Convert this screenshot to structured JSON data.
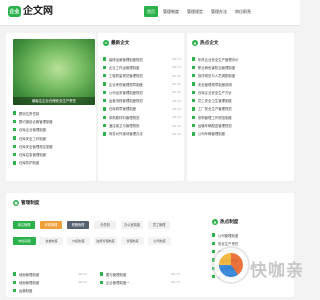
{
  "header": {
    "logo_badge": "企业",
    "logo_text": "企文网",
    "nav": [
      "首页",
      "管理制度",
      "管理规定",
      "管理办法",
      "岗位职责"
    ]
  },
  "featured": {
    "caption": "编者注企业仓储安全生产责任"
  },
  "left_list": [
    "履岗位责任制",
    "履约钢品合格管理制度",
    "仓库企业管理制度",
    "仓库安全工作制度",
    "仓库安全管理规定制度",
    "仓库应急管理制度",
    "仓库防护制度"
  ],
  "latest": {
    "title": "最新企文",
    "items": [
      {
        "text": "装修运营管理制度规范",
        "date": "08-13"
      },
      {
        "text": "企业工作运管理制度",
        "date": "08-13"
      },
      {
        "text": "工程质量规范管理规范",
        "date": "08-13"
      },
      {
        "text": "企业考勤管理规章制度",
        "date": "08-13"
      },
      {
        "text": "公司治安管理制度规范",
        "date": "08-13"
      },
      {
        "text": "运营流程管理制度规范",
        "date": "08-13"
      },
      {
        "text": "仓库规章管理制度",
        "date": "08-13"
      },
      {
        "text": "采购原材料管理规范",
        "date": "08-13"
      },
      {
        "text": "酒店保卫与管理规则",
        "date": "08-13"
      },
      {
        "text": "商务对外接待管理办法",
        "date": "08-13"
      }
    ]
  },
  "hot": {
    "title": "热点企文",
    "items": [
      "年终企业安全生产管理评价",
      "职业病危害防治管理制度",
      "操作规范与人员调配制度",
      "安全管理规章制度说明",
      "仓库企业安全生产方针",
      "员工安全卫生管理制度",
      "工厂安全生产管理规范",
      "采购管理工作规范制度",
      "运输车辆配送管理规范",
      "公司车辆管理制度"
    ]
  },
  "system": {
    "title": "管理制度",
    "tabs": [
      "岗位管理",
      "考勤管理",
      "薪酬管理",
      "责任制",
      "办公室制度",
      "员工管理"
    ],
    "pills": [
      "岗位职责",
      "食堂制度",
      "内控制度",
      "监督管理制度",
      "管理制度",
      "公司制度"
    ],
    "list_a": [
      {
        "text": "地面管理制度",
        "date": "08-13"
      },
      {
        "text": "地面管理制度",
        "date": "08-13"
      },
      {
        "text": "运营制度"
      }
    ],
    "list_b": [
      {
        "text": "要与管理制度",
        "date": "08-13"
      },
      {
        "text": "企业管理制度一",
        "date": "08-13"
      }
    ]
  },
  "hot2": {
    "title": "热点制度",
    "items": [
      "公司管理制度",
      "安全生产责任",
      "仓库管理制度",
      "质量管理制度",
      "办公管理规定",
      "公司管理制度"
    ]
  },
  "watermark": {
    "text": "快咖亲"
  },
  "colors": {
    "brand": "#2bb24c",
    "background": "#f3f3f3",
    "orange_tab": "#f0a03a"
  }
}
